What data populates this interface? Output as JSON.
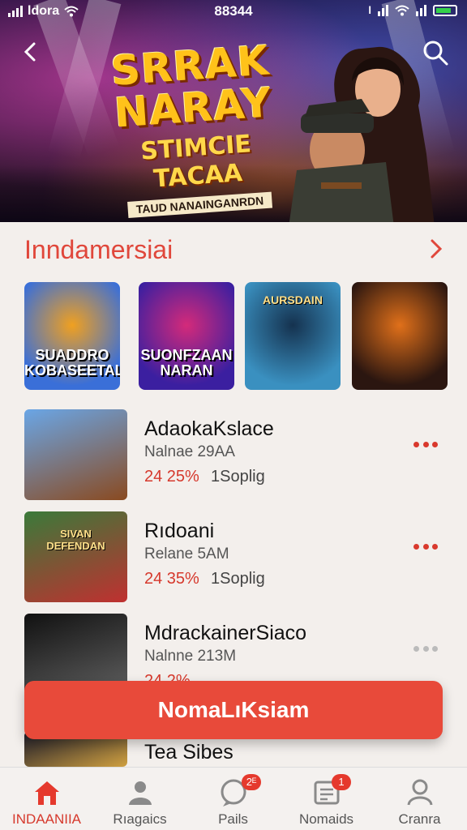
{
  "status_bar": {
    "carrier": "ldora",
    "time": "88344",
    "carrier_right": "l"
  },
  "hero": {
    "title_line1": "SRRAK",
    "title_line2": "NARAY",
    "title_line3": "STIMCIE TACAA",
    "title_line4": "TAUD NANAINGANRDN",
    "back_icon": "chevron-left-icon",
    "search_icon": "search-icon"
  },
  "section": {
    "title": "Inndamersiai",
    "arrow_icon": "chevron-right-icon"
  },
  "tiles": [
    {
      "top_label": "",
      "label": "SUADDRO\nKOBASEETALI",
      "colors": [
        "#f0a020",
        "#3a6fd8"
      ]
    },
    {
      "top_label": "",
      "label": "SUONFZAAN\nNARAN",
      "colors": [
        "#d42a7a",
        "#3b1fa0"
      ]
    },
    {
      "top_label": "AURSDAIN",
      "label": "",
      "colors": [
        "#15324f",
        "#3a90c0"
      ]
    },
    {
      "top_label": "",
      "label": "",
      "colors": [
        "#e0701a",
        "#2b1610"
      ]
    }
  ],
  "list": [
    {
      "title": "AdaokaKslace",
      "sub": "Nalnae 29AA",
      "pct": "24 25%",
      "meta": "1Soplig",
      "thumb_label": "",
      "colors": [
        "#6aa6e6",
        "#8a4a20"
      ]
    },
    {
      "title": "Rıdoani",
      "sub": "Relane 5AM",
      "pct": "24 35%",
      "meta": "1Soplig",
      "thumb_label": "SIVAN\nDEFENDAN",
      "colors": [
        "#3a7a3a",
        "#c03030"
      ]
    },
    {
      "title": "MdrackainerSiaco",
      "sub": "Nalnne 213M",
      "pct": "24 2%",
      "meta": "",
      "thumb_label": "",
      "colors": [
        "#111111",
        "#666666"
      ]
    },
    {
      "title": "Tea Sibes",
      "sub": "",
      "pct": "",
      "meta": "",
      "thumb_label": "",
      "colors": [
        "#1a1a2a",
        "#d0a040"
      ]
    }
  ],
  "cta": {
    "label": "NomaLıKsiam"
  },
  "nav": [
    {
      "label": "INDAANIIA",
      "icon": "home-icon",
      "badge": "",
      "active": true
    },
    {
      "label": "Rıagaics",
      "icon": "profile-icon",
      "badge": "",
      "active": false
    },
    {
      "label": "Pails",
      "icon": "chat-icon",
      "badge": "2ᴱ",
      "active": false
    },
    {
      "label": "Nomaids",
      "icon": "document-icon",
      "badge": "1",
      "active": false
    },
    {
      "label": "Cranra",
      "icon": "user-icon",
      "badge": "",
      "active": false
    }
  ],
  "colors": {
    "accent": "#e0473b",
    "cta": "#e84a3a"
  }
}
